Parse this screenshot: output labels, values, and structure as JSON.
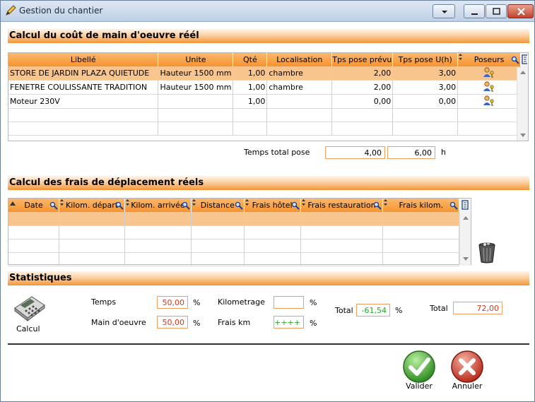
{
  "window": {
    "title": "Gestion du chantier"
  },
  "section1": {
    "title": "Calcul du coût de main d'oeuvre réél"
  },
  "labor_table": {
    "columns": [
      "Libellé",
      "Unite",
      "Qté",
      "Localisation",
      "Tps pose prévu",
      "Tps pose U(h)",
      "Poseurs"
    ],
    "rows": [
      {
        "libelle": "STORE DE JARDIN PLAZA QUIETUDE",
        "unite": "Hauteur 1500 mm",
        "qte": "1,00",
        "localisation": "chambre",
        "tps_prevu": "2,00",
        "tps_u": "3,00"
      },
      {
        "libelle": "FENETRE COULISSANTE TRADITION",
        "unite": "Hauteur 1500 mm",
        "qte": "1,00",
        "localisation": "chambre",
        "tps_prevu": "2,00",
        "tps_u": "3,00"
      },
      {
        "libelle": "Moteur 230V",
        "unite": "",
        "qte": "1,00",
        "localisation": "",
        "tps_prevu": "0,00",
        "tps_u": "0,00"
      }
    ]
  },
  "temps_total": {
    "label": "Temps total pose",
    "value1": "4,00",
    "value2": "6,00",
    "unit": "h"
  },
  "section2": {
    "title": "Calcul des frais de déplacement réels"
  },
  "travel_table": {
    "columns": [
      "Date",
      "Kilom. départ",
      "Kilom. arrivée",
      "Distance",
      "Frais hôtel",
      "Frais restauration",
      "Frais kilom."
    ]
  },
  "section3": {
    "title": "Statistiques"
  },
  "stats": {
    "calcul_label": "Calcul",
    "temps_label": "Temps",
    "temps_value": "50,00",
    "temps_unit": "%",
    "main_label": "Main d'oeuvre",
    "main_value": "50,00",
    "main_unit": "%",
    "km_label": "Kilometrage",
    "km_value": "",
    "km_unit": "%",
    "frais_km_label": "Frais km",
    "frais_km_value": "++++",
    "frais_km_unit": "%",
    "total1_label": "Total",
    "total1_value": "-61,54",
    "total1_unit": "%",
    "total2_label": "Total",
    "total2_value": "72,00"
  },
  "buttons": {
    "validate": "Valider",
    "cancel": "Annuler"
  },
  "colors": {
    "accent": "#f39438",
    "selected_row": "#f8c58e",
    "green_value": "#2ca52c",
    "red_value": "#d03a1c"
  }
}
